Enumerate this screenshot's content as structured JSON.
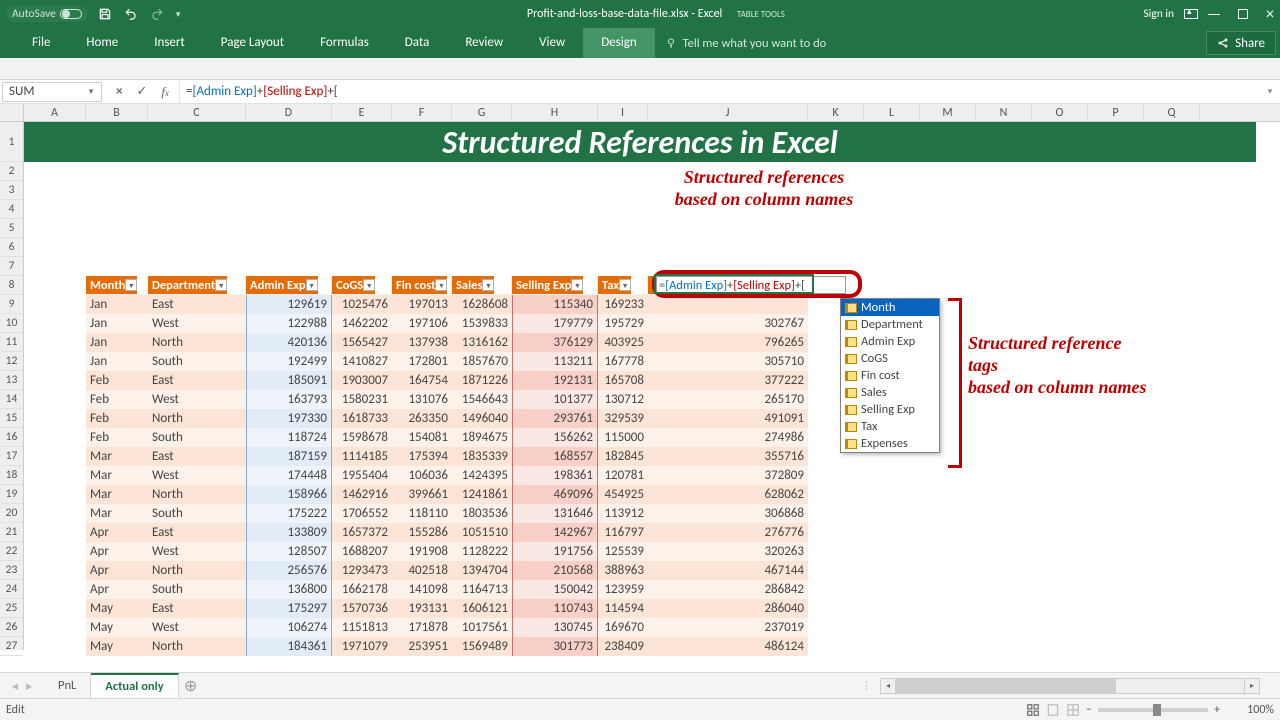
{
  "titlebar": {
    "autosave_label": "AutoSave",
    "autosave_state": "Off",
    "filename": "Profit-and-loss-base-data-file.xlsx - Excel",
    "context_group": "Table Tools",
    "signin": "Sign in"
  },
  "ribbon": {
    "tabs": [
      "File",
      "Home",
      "Insert",
      "Page Layout",
      "Formulas",
      "Data",
      "Review",
      "View",
      "Design"
    ],
    "active_tab": "Design",
    "tellme": "Tell me what you want to do",
    "share": "Share"
  },
  "formula_bar": {
    "name_box": "SUM",
    "formula_prefix": "=",
    "ref1": "[Admin Exp]",
    "plus": "+",
    "ref2": "[Selling Exp]",
    "tail": "+["
  },
  "columns": [
    "A",
    "B",
    "C",
    "D",
    "E",
    "F",
    "G",
    "H",
    "I",
    "J",
    "K",
    "L",
    "M",
    "N",
    "O",
    "P",
    "Q"
  ],
  "mega_title": "Structured References in Excel",
  "table": {
    "headers": [
      "Month",
      "Department",
      "Admin Exp",
      "CoGS",
      "Fin cost",
      "Sales",
      "Selling Exp",
      "Tax",
      "Expenses"
    ],
    "rows": [
      [
        "Jan",
        "East",
        129619,
        1025476,
        197013,
        1628608,
        115340,
        169233,
        ""
      ],
      [
        "Jan",
        "West",
        122988,
        1462202,
        197106,
        1539833,
        179779,
        195729,
        302767
      ],
      [
        "Jan",
        "North",
        420136,
        1565427,
        137938,
        1316162,
        376129,
        403925,
        796265
      ],
      [
        "Jan",
        "South",
        192499,
        1410827,
        172801,
        1857670,
        113211,
        167778,
        305710
      ],
      [
        "Feb",
        "East",
        185091,
        1903007,
        164754,
        1871226,
        192131,
        165708,
        377222
      ],
      [
        "Feb",
        "West",
        163793,
        1580231,
        131076,
        1546643,
        101377,
        130712,
        265170
      ],
      [
        "Feb",
        "North",
        197330,
        1618733,
        263350,
        1496040,
        293761,
        329539,
        491091
      ],
      [
        "Feb",
        "South",
        118724,
        1598678,
        154081,
        1894675,
        156262,
        115000,
        274986
      ],
      [
        "Mar",
        "East",
        187159,
        1114185,
        175394,
        1835339,
        168557,
        182845,
        355716
      ],
      [
        "Mar",
        "West",
        174448,
        1955404,
        106036,
        1424395,
        198361,
        120781,
        372809
      ],
      [
        "Mar",
        "North",
        158966,
        1462916,
        399661,
        1241861,
        469096,
        454925,
        628062
      ],
      [
        "Mar",
        "South",
        175222,
        1706552,
        118110,
        1803536,
        131646,
        113912,
        306868
      ],
      [
        "Apr",
        "East",
        133809,
        1657372,
        155286,
        1051510,
        142967,
        116797,
        276776
      ],
      [
        "Apr",
        "West",
        128507,
        1688207,
        191908,
        1128222,
        191756,
        125539,
        320263
      ],
      [
        "Apr",
        "North",
        256576,
        1293473,
        402518,
        1394704,
        210568,
        388963,
        467144
      ],
      [
        "Apr",
        "South",
        136800,
        1662178,
        141098,
        1164713,
        150042,
        123959,
        286842
      ],
      [
        "May",
        "East",
        175297,
        1570736,
        193131,
        1606121,
        110743,
        114594,
        286040
      ],
      [
        "May",
        "West",
        106274,
        1151813,
        171878,
        1017561,
        130745,
        169670,
        237019
      ],
      [
        "May",
        "North",
        184361,
        1971079,
        253951,
        1569489,
        301773,
        238409,
        486124
      ]
    ]
  },
  "annotations": {
    "top": "Structured references\nbased on column names",
    "right": "Structured reference\ntags\nbased on column names"
  },
  "intellisense": [
    "Month",
    "Department",
    "Admin Exp",
    "CoGS",
    "Fin cost",
    "Sales",
    "Selling Exp",
    "Tax",
    "Expenses"
  ],
  "intellisense_selected": 0,
  "sheets": {
    "tabs": [
      "PnL",
      "Actual only"
    ],
    "active": "Actual only"
  },
  "statusbar": {
    "mode": "Edit",
    "zoom": "100%"
  }
}
